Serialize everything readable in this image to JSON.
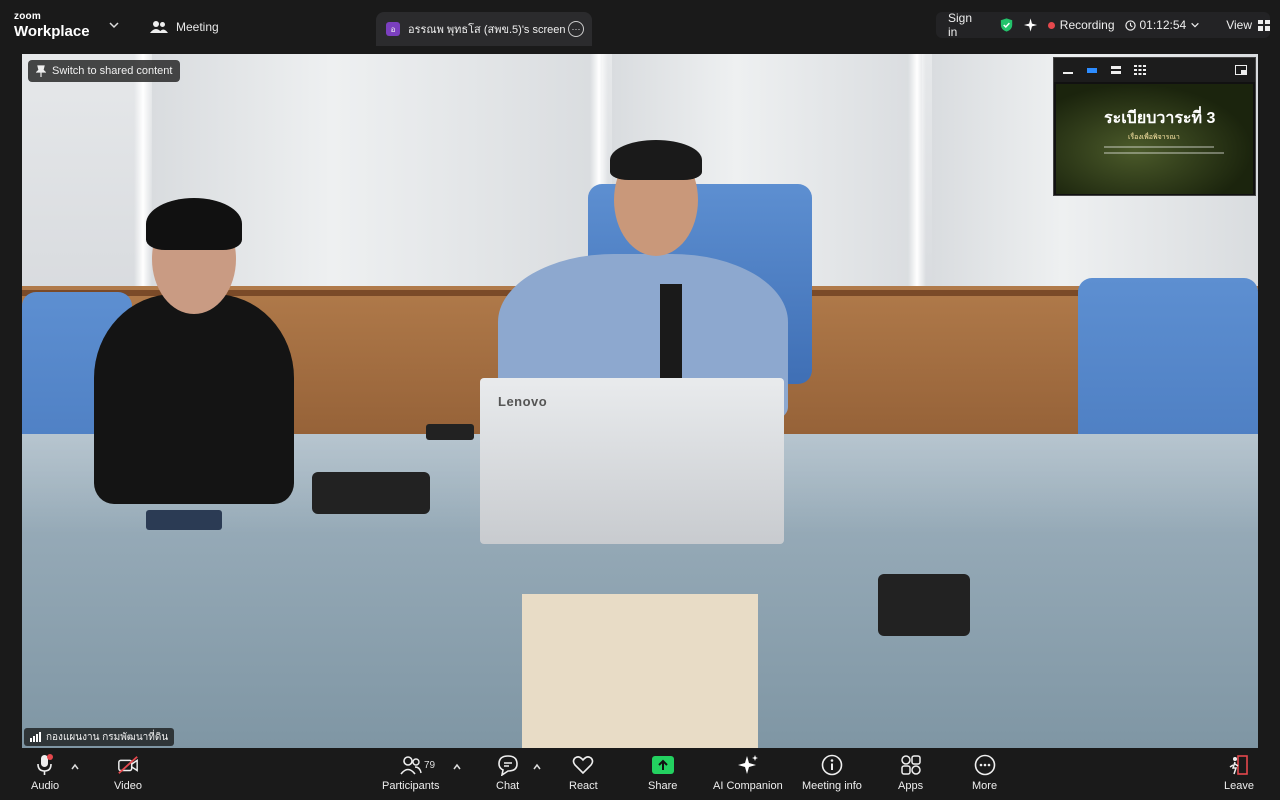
{
  "brand": {
    "line1": "zoom",
    "line2": "Workplace"
  },
  "top": {
    "meeting_label": "Meeting",
    "share_tab_avatar": "อ",
    "share_tab_label": "อรรณพ พุทธโส (สพข.5)'s screen",
    "sign_in": "Sign in",
    "recording_label": "Recording",
    "timer": "01:12:54",
    "view_label": "View"
  },
  "video": {
    "switch_label": "Switch to shared content",
    "monitor_brand": "Lenovo",
    "participant_name": "กองแผนงาน กรมพัฒนาที่ดิน"
  },
  "thumbnail": {
    "slide_title": "ระเบียบวาระที่ 3",
    "slide_subtitle": "เรื่องเพื่อพิจารณา"
  },
  "toolbar": {
    "audio": "Audio",
    "video": "Video",
    "participants": "Participants",
    "participant_count": "79",
    "chat": "Chat",
    "react": "React",
    "share": "Share",
    "ai_companion": "AI Companion",
    "meeting_info": "Meeting info",
    "apps": "Apps",
    "more": "More",
    "leave": "Leave"
  },
  "colors": {
    "recording_dot": "#e5484d",
    "share_green": "#23d160",
    "shield_green": "#23c26b",
    "leave_red": "#e5484d"
  }
}
